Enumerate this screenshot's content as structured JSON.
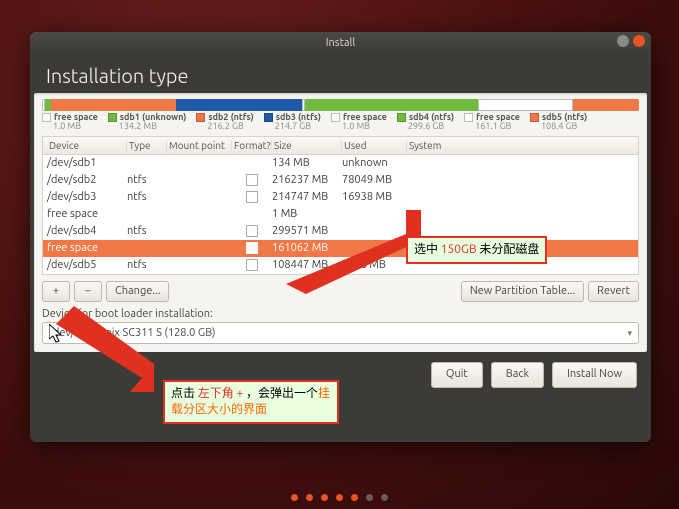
{
  "window": {
    "title": "Install"
  },
  "header": {
    "title": "Installation type"
  },
  "legend": [
    {
      "label": "free space",
      "size": "1.0 MB",
      "color": "#ffffff",
      "border": "#bbb"
    },
    {
      "label": "sdb1 (unknown)",
      "size": "134.2 MB",
      "color": "#6fbb3f"
    },
    {
      "label": "sdb2 (ntfs)",
      "size": "216.2 GB",
      "color": "#f07746"
    },
    {
      "label": "sdb3 (ntfs)",
      "size": "214.7 GB",
      "color": "#1e5aa8"
    },
    {
      "label": "free space",
      "size": "1.0 MB",
      "color": "#ffffff",
      "border": "#bbb"
    },
    {
      "label": "sdb4 (ntfs)",
      "size": "299.6 GB",
      "color": "#6fbb3f"
    },
    {
      "label": "free space",
      "size": "161.1 GB",
      "color": "#ffffff",
      "border": "#bbb"
    },
    {
      "label": "sdb5 (ntfs)",
      "size": "108.4 GB",
      "color": "#f07746"
    }
  ],
  "columns": {
    "c0": "Device",
    "c1": "Type",
    "c2": "Mount point",
    "c3": "Format?",
    "c4": "Size",
    "c5": "Used",
    "c6": "System"
  },
  "rows": [
    {
      "device": "/dev/sdb1",
      "type": "",
      "mount": "",
      "size": "134 MB",
      "used": "unknown",
      "system": "",
      "selected": false,
      "fmt": false
    },
    {
      "device": "/dev/sdb2",
      "type": "ntfs",
      "mount": "",
      "size": "216237 MB",
      "used": "78049 MB",
      "system": "",
      "selected": false,
      "fmt": true
    },
    {
      "device": "/dev/sdb3",
      "type": "ntfs",
      "mount": "",
      "size": "214747 MB",
      "used": "16938 MB",
      "system": "",
      "selected": false,
      "fmt": true
    },
    {
      "device": "free space",
      "type": "",
      "mount": "",
      "size": "1 MB",
      "used": "",
      "system": "",
      "selected": false,
      "fmt": false
    },
    {
      "device": "/dev/sdb4",
      "type": "ntfs",
      "mount": "",
      "size": "299571 MB",
      "used": "",
      "system": "",
      "selected": false,
      "fmt": true
    },
    {
      "device": "free space",
      "type": "",
      "mount": "",
      "size": "161062 MB",
      "used": "",
      "system": "",
      "selected": true,
      "fmt": true
    },
    {
      "device": "/dev/sdb5",
      "type": "ntfs",
      "mount": "",
      "size": "108447 MB",
      "used": "7988 MB",
      "system": "",
      "selected": false,
      "fmt": true
    }
  ],
  "toolbar": {
    "add": "+",
    "remove": "−",
    "change": "Change...",
    "new_table": "New Partition Table...",
    "revert": "Revert"
  },
  "boot": {
    "label": "Device for boot loader installation:",
    "value": "/dev/sda               hynix SC311 S (128.0 GB)"
  },
  "footer": {
    "quit": "Quit",
    "back": "Back",
    "install": "Install Now"
  },
  "annotations": {
    "note1_a": "选中 ",
    "note1_b": "150GB",
    "note1_c": " 未分配磁盘",
    "note2_a": "点击 ",
    "note2_b": "左下角  +",
    "note2_c": " ，会弹出一个",
    "note2_d": "挂载分区大小的界面"
  }
}
